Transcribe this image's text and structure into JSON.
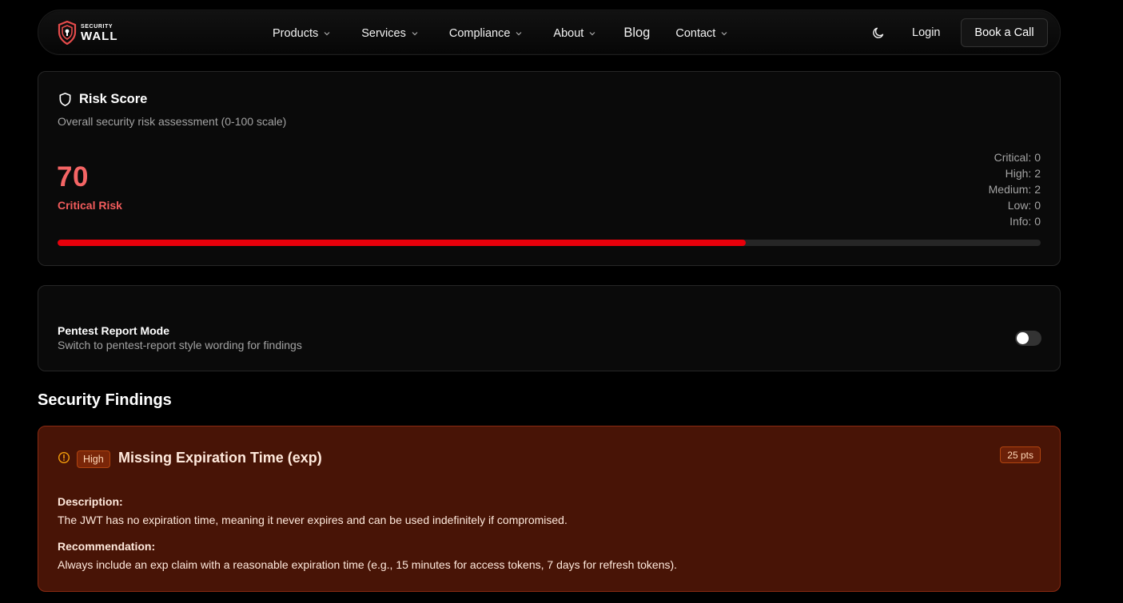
{
  "nav": {
    "logo_small": "SECURITY",
    "logo_big": "WALL",
    "items": [
      {
        "label": "Products",
        "has_dropdown": true
      },
      {
        "label": "Services",
        "has_dropdown": true
      },
      {
        "label": "Compliance",
        "has_dropdown": true
      },
      {
        "label": "About",
        "has_dropdown": true
      },
      {
        "label": "Blog",
        "has_dropdown": false
      },
      {
        "label": "Contact",
        "has_dropdown": true
      }
    ],
    "theme_toggle_icon": "moon-icon",
    "login_label": "Login",
    "cta_label": "Book a Call"
  },
  "risk": {
    "title": "Risk Score",
    "subtitle": "Overall security risk assessment (0-100 scale)",
    "score": "70",
    "score_fraction": 0.7,
    "level": "Critical Risk",
    "counts": [
      "Critical: 0",
      "High: 2",
      "Medium: 2",
      "Low: 0",
      "Info: 0"
    ],
    "accent_color": "#f56565",
    "bar_color": "#e8000b"
  },
  "mode": {
    "title": "Pentest Report Mode",
    "subtitle": "Switch to pentest-report style wording for findings",
    "enabled": false
  },
  "findings_title": "Security Findings",
  "findings": [
    {
      "severity": "High",
      "title": "Missing Expiration Time (exp)",
      "points": "25 pts",
      "description_label": "Description:",
      "description": "The JWT has no expiration time, meaning it never expires and can be used indefinitely if compromised.",
      "recommendation_label": "Recommendation:",
      "recommendation": "Always include an exp claim with a reasonable expiration time (e.g., 15 minutes for access tokens, 7 days for refresh tokens).",
      "card_color": "#481406"
    }
  ]
}
